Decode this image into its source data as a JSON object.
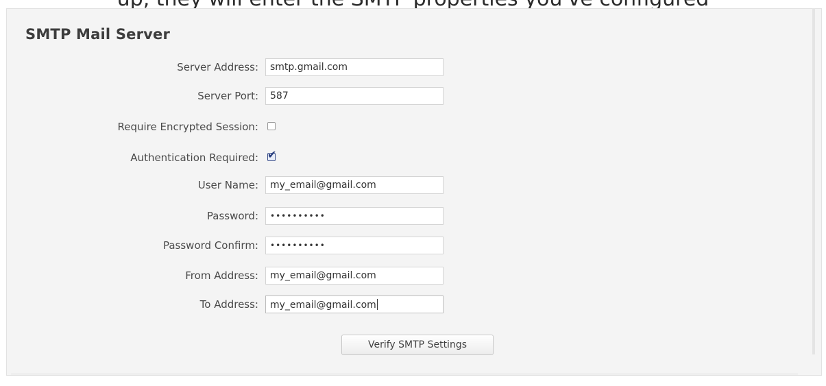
{
  "caption": "up, they will enter the SMTP properties you've configured",
  "section": {
    "title": "SMTP Mail Server"
  },
  "fields": {
    "server_address": {
      "label": "Server Address:",
      "value": "smtp.gmail.com"
    },
    "server_port": {
      "label": "Server Port:",
      "value": "587"
    },
    "require_encrypted": {
      "label": "Require Encrypted Session:",
      "checked": false
    },
    "auth_required": {
      "label": "Authentication Required:",
      "checked": true,
      "tick": "✔"
    },
    "user_name": {
      "label": "User Name:",
      "value": "my_email@gmail.com"
    },
    "password": {
      "label": "Password:",
      "value": "••••••••••"
    },
    "password_confirm": {
      "label": "Password Confirm:",
      "value": "••••••••••"
    },
    "from_address": {
      "label": "From Address:",
      "value": "my_email@gmail.com"
    },
    "to_address": {
      "label": "To Address:",
      "value": "my_email@gmail.com"
    }
  },
  "buttons": {
    "verify_label": "Verify SMTP Settings"
  }
}
